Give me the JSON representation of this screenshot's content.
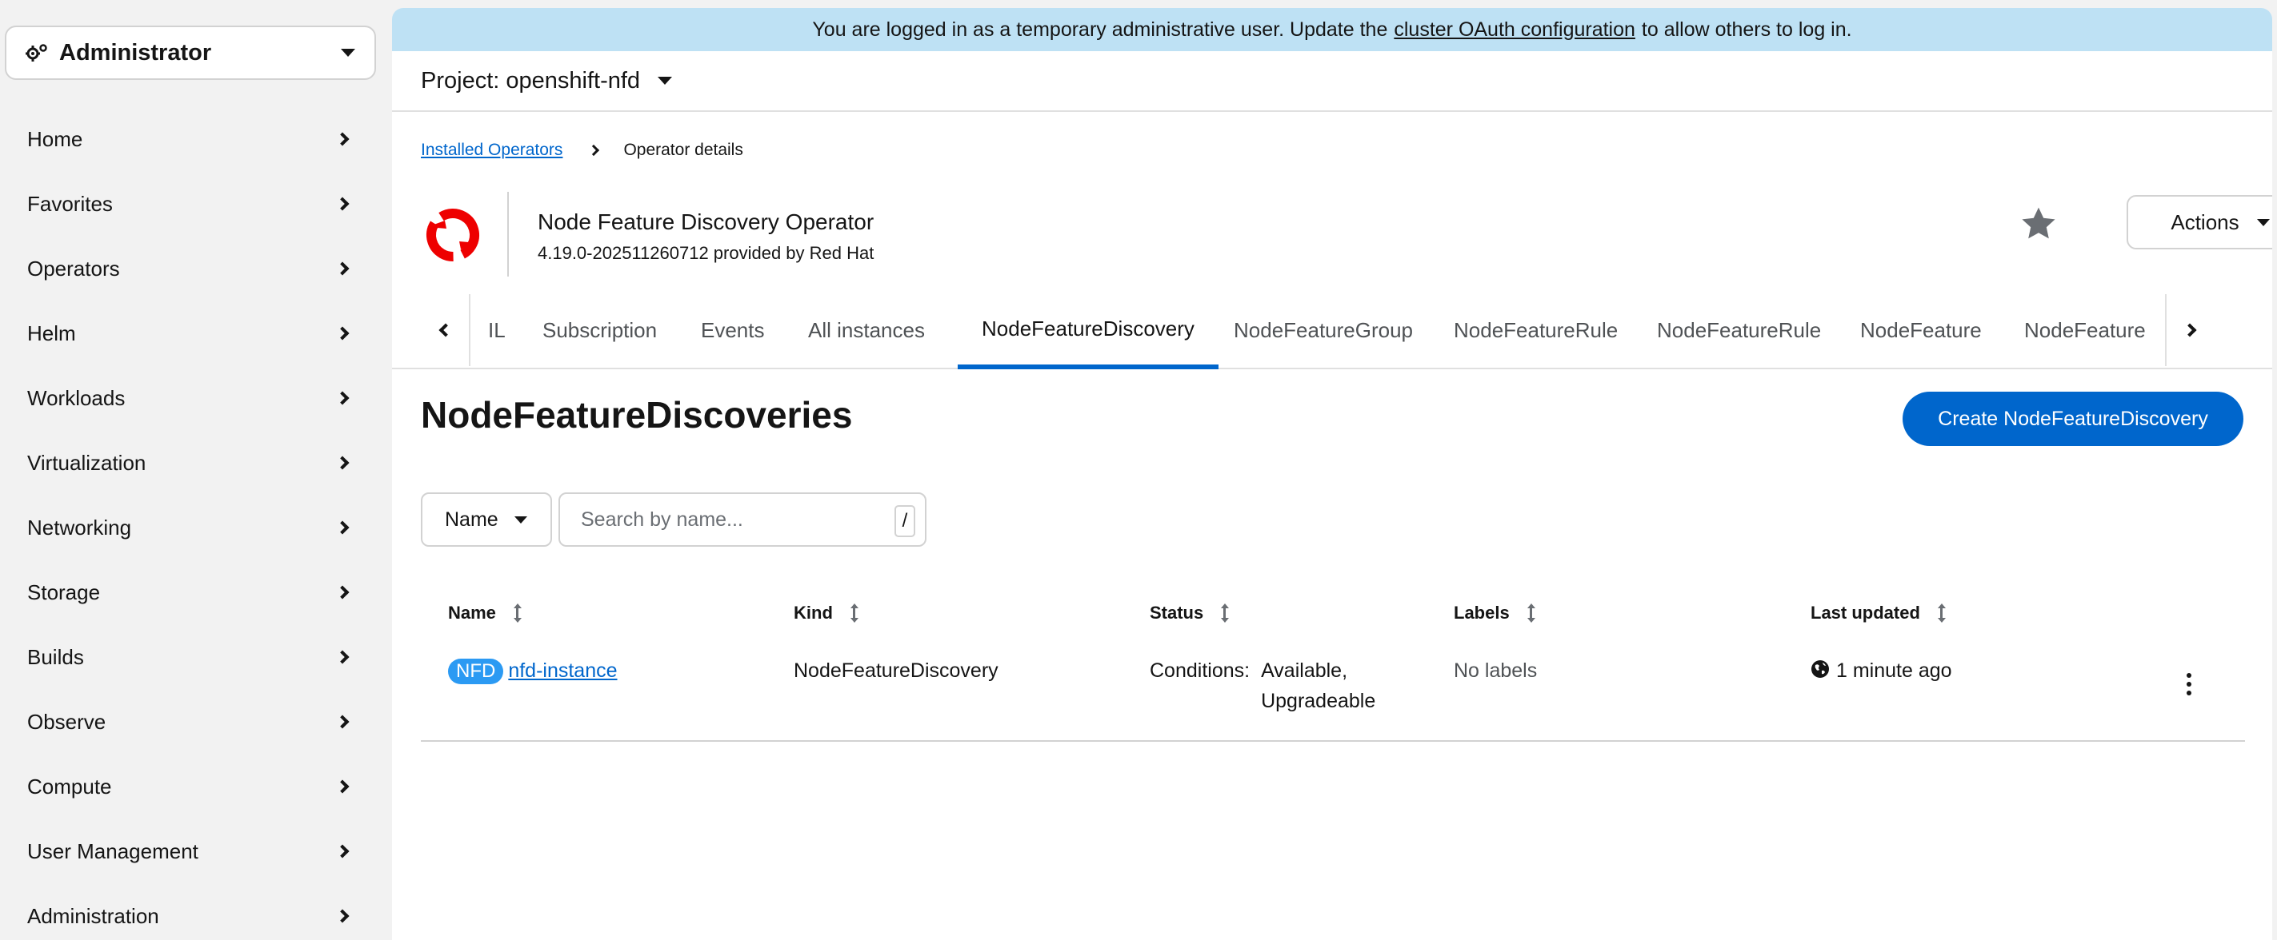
{
  "sidebar": {
    "perspective_label": "Administrator",
    "items": [
      {
        "label": "Home"
      },
      {
        "label": "Favorites"
      },
      {
        "label": "Operators"
      },
      {
        "label": "Helm"
      },
      {
        "label": "Workloads"
      },
      {
        "label": "Virtualization"
      },
      {
        "label": "Networking"
      },
      {
        "label": "Storage"
      },
      {
        "label": "Builds"
      },
      {
        "label": "Observe"
      },
      {
        "label": "Compute"
      },
      {
        "label": "User Management"
      },
      {
        "label": "Administration"
      }
    ]
  },
  "banner": {
    "text_before": "You are logged in as a temporary administrative user. Update the",
    "link_text": "cluster OAuth configuration",
    "text_after": "to allow others to log in."
  },
  "project": {
    "label": "Project: openshift-nfd"
  },
  "breadcrumb": {
    "parent": "Installed Operators",
    "current": "Operator details"
  },
  "operator": {
    "name": "Node Feature Discovery Operator",
    "version": "4.19.0-202511260712 provided by Red Hat",
    "logo_color": "#ee0000",
    "actions_label": "Actions"
  },
  "tabs": [
    {
      "label": "IL"
    },
    {
      "label": "Subscription"
    },
    {
      "label": "Events"
    },
    {
      "label": "All instances"
    },
    {
      "label": "NodeFeatureDiscovery",
      "active": true
    },
    {
      "label": "NodeFeatureGroup"
    },
    {
      "label": "NodeFeatureRule"
    },
    {
      "label": "NodeFeatureRule"
    },
    {
      "label": "NodeFeature"
    },
    {
      "label": "NodeFeature"
    }
  ],
  "page": {
    "title": "NodeFeatureDiscoveries",
    "create_label": "Create NodeFeatureDiscovery",
    "accent_color": "#0066cc"
  },
  "filter": {
    "select_value": "Name",
    "search_placeholder": "Search by name...",
    "shortcut_key": "/"
  },
  "table": {
    "columns": [
      "Name",
      "Kind",
      "Status",
      "Labels",
      "Last updated"
    ],
    "rows": [
      {
        "badge": "NFD",
        "name": "nfd-instance",
        "kind": "NodeFeatureDiscovery",
        "status_label": "Conditions:",
        "status_line1": "Available,",
        "status_line2": "Upgradeable",
        "labels": "No labels",
        "last_updated": "1 minute ago"
      }
    ]
  }
}
